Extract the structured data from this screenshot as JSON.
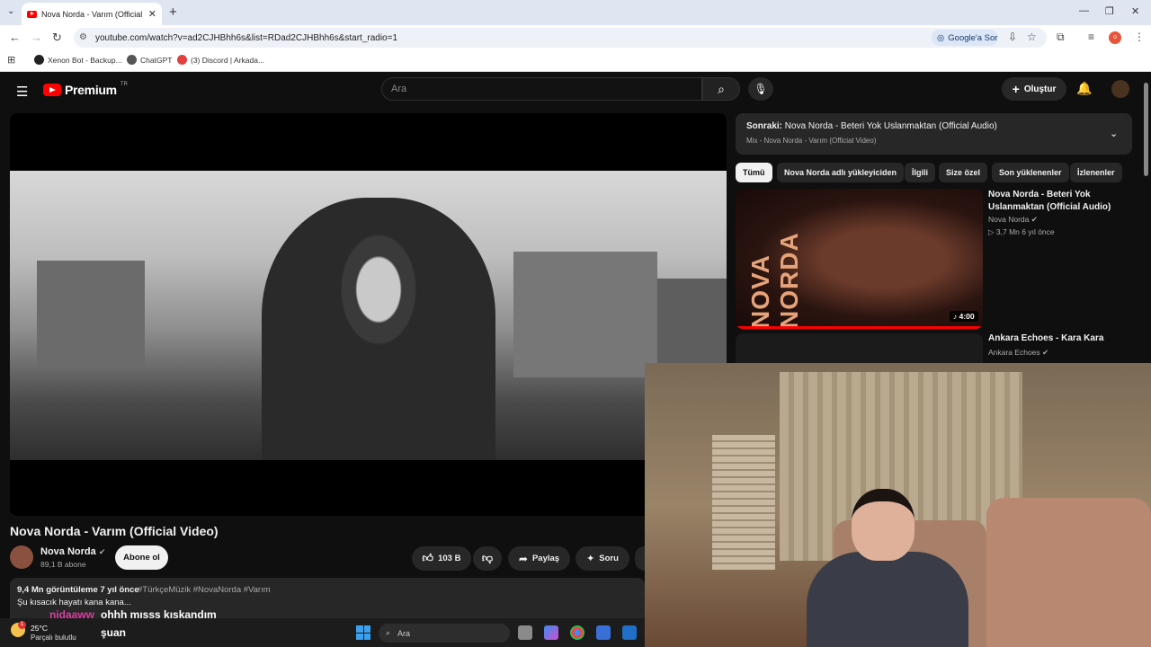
{
  "browser": {
    "tab_title": "Nova Norda - Varım (Official Vi",
    "url": "youtube.com/watch?v=ad2CJHBhh6s&list=RDad2CJHBhh6s&start_radio=1",
    "ask_google": "Google'a Sor",
    "profile_initial": "o",
    "bookmarks": [
      {
        "label": "Xenon Bot - Backup...",
        "color": "#222222"
      },
      {
        "label": "ChatGPT",
        "color": "#555555"
      },
      {
        "label": "(3) Discord | Arkada...",
        "color": "#e04040"
      }
    ]
  },
  "youtube": {
    "logo": "Premium",
    "region": "TR",
    "search_placeholder": "Ara",
    "create_label": "Oluştur",
    "video": {
      "title": "Nova Norda - Varım (Official Video)",
      "channel": "Nova Norda",
      "subscribers": "89,1 B abone",
      "subscribe_label": "Abone ol",
      "likes": "103 B",
      "share_label": "Paylaş",
      "ask_label": "Soru",
      "views": "9,4 Mn görüntüleme  7 yıl önce",
      "tags": "#TürkçeMüzik #NovaNorda #Varım",
      "description": "Şu kısacık hayatı kana kana..."
    },
    "up_next": {
      "prefix": "Sonraki:",
      "title": "Nova Norda - Beteri Yok Uslanmaktan (Official Audio)",
      "mix": "Mix - Nova Norda - Varım (Official Video)"
    },
    "chips": [
      "Tümü",
      "Nova Norda adlı yükleyiciden",
      "İlgili",
      "Size özel",
      "Son yüklenenler",
      "İzlenenler"
    ],
    "recommendations": [
      {
        "title": "Nova Norda - Beteri Yok Uslanmaktan (Official Audio)",
        "channel": "Nova Norda",
        "meta": "▷ 3,7 Mn   6 yıl önce",
        "duration": "4:00",
        "thumb_text": "NOVA NORDA"
      },
      {
        "title": "Ankara Echoes - Kara Kara",
        "channel": "Ankara Echoes"
      }
    ]
  },
  "overlay": {
    "chat_user": "nidaaww",
    "chat_message": "ohhh mısss kıskandım",
    "chat_message2": "şuan"
  },
  "taskbar": {
    "temperature": "25°C",
    "condition": "Parçalı bulutlu",
    "search_placeholder": "Ara",
    "weather_badge": "1"
  }
}
